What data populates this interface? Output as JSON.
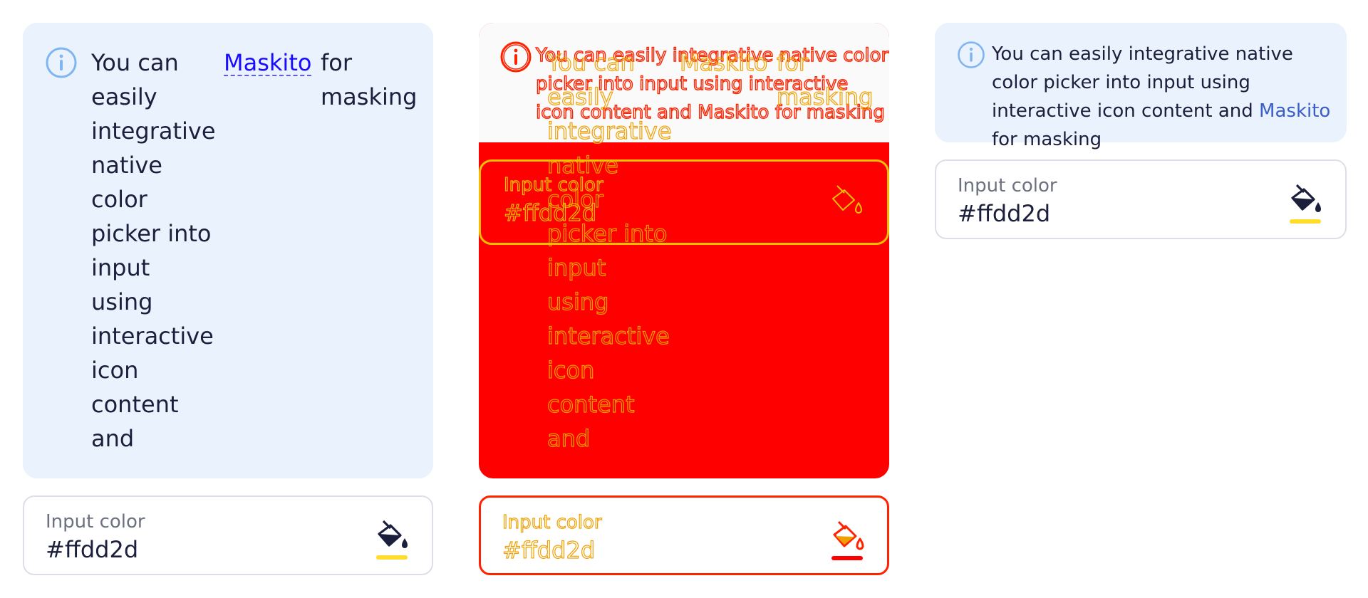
{
  "notification": {
    "segment1": "You can easily integrative native color picker into input using interactive icon content and",
    "words": [
      "You can",
      "easily",
      "integrative",
      "native",
      "color",
      "picker into",
      "input",
      "using",
      "interactive",
      "icon",
      "content",
      "and"
    ],
    "link": "Maskito",
    "tail": "for masking",
    "tail_words": [
      "for",
      "masking"
    ],
    "icon": "info-icon"
  },
  "input": {
    "label": "Input color",
    "value": "#ffdd2d",
    "icon": "paint-bucket-icon",
    "swatch_color": "#ffdd2d"
  },
  "colors": {
    "notification_bg": "#e9f2fd",
    "info_icon": "#7fb5f0",
    "link": "#1a0dff",
    "link_compact": "#3a5ec8",
    "debug_fill": "#ff0000",
    "debug_stroke_warm": "#f0a000"
  }
}
